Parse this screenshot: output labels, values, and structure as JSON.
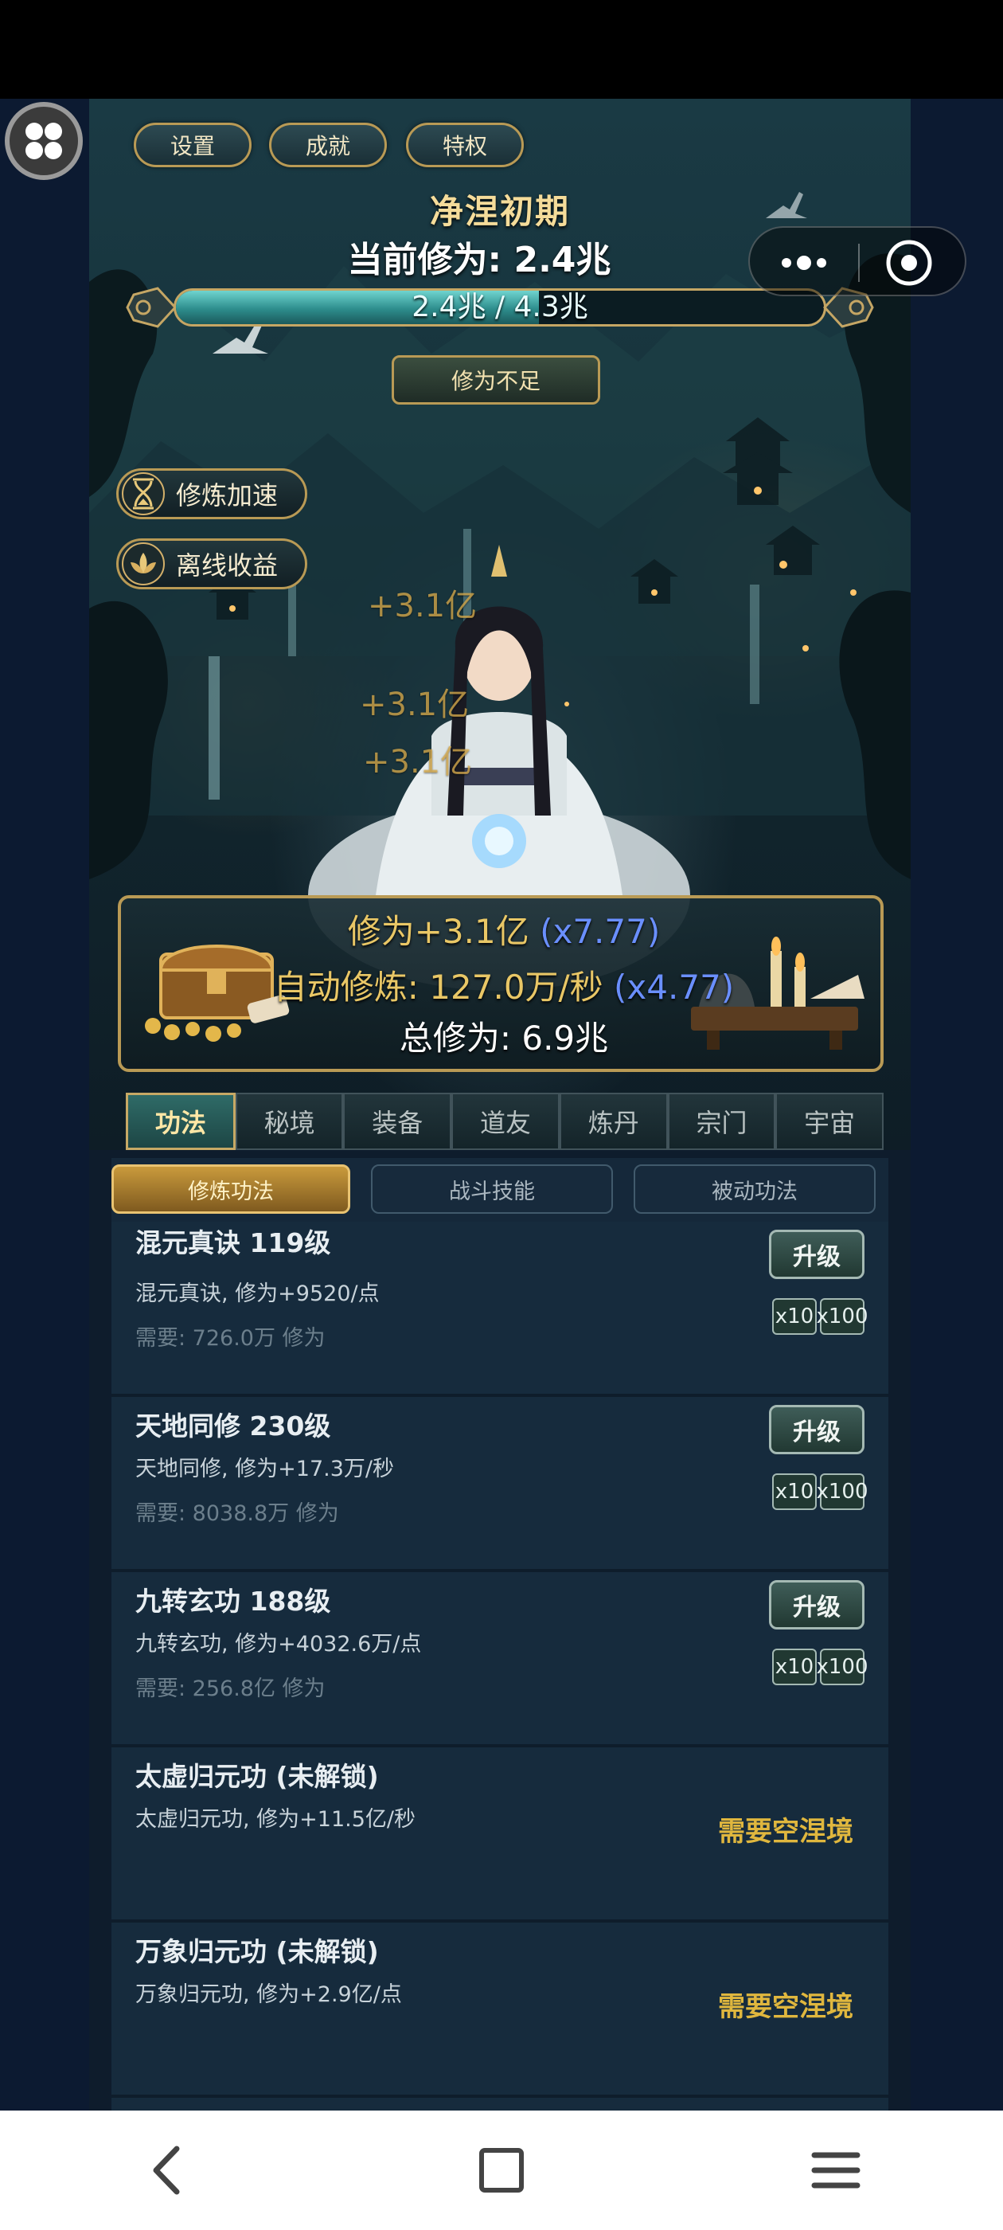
{
  "top_buttons": {
    "settings": "设置",
    "achievements": "成就",
    "privileges": "特权"
  },
  "realm": {
    "name": "净涅初期",
    "current_cultivation": "当前修为: 2.4兆"
  },
  "exp": {
    "text": "2.4兆 / 4.3兆",
    "fill_ratio": 0.56
  },
  "warning": "修为不足",
  "side_buttons": {
    "speed_up": "修炼加速",
    "offline": "离线收益"
  },
  "floating_gains": [
    "+3.1亿",
    "+3.1亿",
    "+3.1亿"
  ],
  "info": {
    "gain_label": "修为+3.1亿",
    "gain_mult": "(x7.77)",
    "auto_label": "自动修炼: 127.0万/秒",
    "auto_mult": "(x4.77)",
    "total": "总修为: 6.9兆"
  },
  "tabs": [
    "功法",
    "秘境",
    "装备",
    "道友",
    "炼丹",
    "宗门",
    "宇宙"
  ],
  "subtabs": [
    "修炼功法",
    "战斗技能",
    "被动功法"
  ],
  "techniques": [
    {
      "name": "混元真诀 119级",
      "desc": "混元真诀, 修为+9520/点",
      "need": "需要: 726.0万 修为",
      "upgrade": "升级",
      "x10": "x10",
      "x100": "x100"
    },
    {
      "name": "天地同修 230级",
      "desc": "天地同修, 修为+17.3万/秒",
      "need": "需要: 8038.8万 修为",
      "upgrade": "升级",
      "x10": "x10",
      "x100": "x100"
    },
    {
      "name": "九转玄功 188级",
      "desc": "九转玄功, 修为+4032.6万/点",
      "need": "需要: 256.8亿 修为",
      "upgrade": "升级",
      "x10": "x10",
      "x100": "x100"
    },
    {
      "name": "太虚归元功 (未解锁)",
      "desc": "太虚归元功, 修为+11.5亿/秒",
      "requirement": "需要空涅境"
    },
    {
      "name": "万象归元功 (未解锁)",
      "desc": "万象归元功, 修为+2.9亿/点",
      "requirement": "需要空涅境"
    }
  ],
  "colors": {
    "gold": "#e9c766",
    "frame": "#b99a55",
    "multiplier_blue": "#6a8fff",
    "requirement": "#e0b73e"
  },
  "icons": [
    "menu-grid-icon",
    "more-dots-icon",
    "close-target-icon",
    "hourglass-icon",
    "lotus-icon",
    "back-icon",
    "home-square-icon",
    "menu-lines-icon"
  ]
}
